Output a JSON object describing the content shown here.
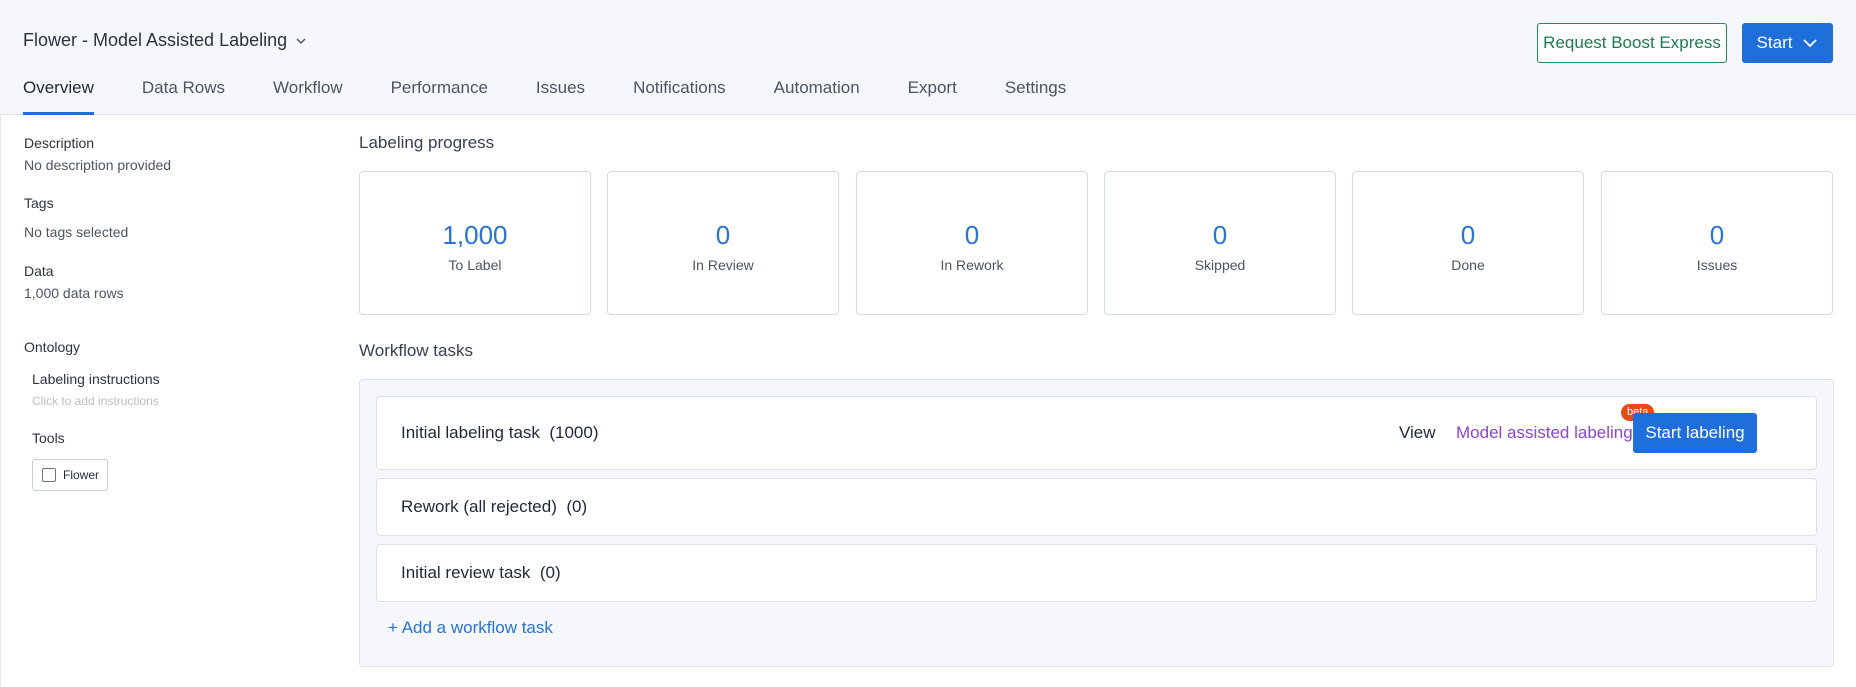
{
  "header": {
    "project_title": "Flower - Model Assisted Labeling",
    "boost_label": "Request Boost Express",
    "start_label": "Start"
  },
  "tabs": [
    {
      "label": "Overview",
      "active": true
    },
    {
      "label": "Data Rows"
    },
    {
      "label": "Workflow"
    },
    {
      "label": "Performance"
    },
    {
      "label": "Issues"
    },
    {
      "label": "Notifications"
    },
    {
      "label": "Automation"
    },
    {
      "label": "Export"
    },
    {
      "label": "Settings"
    }
  ],
  "sidebar": {
    "description_label": "Description",
    "description_value": "No description provided",
    "tags_label": "Tags",
    "tags_value": "No tags selected",
    "data_label": "Data",
    "data_value": "1,000 data rows",
    "ontology_label": "Ontology",
    "instructions_label": "Labeling instructions",
    "instructions_hint": "Click to add instructions",
    "tools_label": "Tools",
    "tool_name": "Flower"
  },
  "progress": {
    "title": "Labeling progress",
    "stats": [
      {
        "value": "1,000",
        "label": "To Label"
      },
      {
        "value": "0",
        "label": "In Review"
      },
      {
        "value": "0",
        "label": "In Rework"
      },
      {
        "value": "0",
        "label": "Skipped"
      },
      {
        "value": "0",
        "label": "Done"
      },
      {
        "value": "0",
        "label": "Issues"
      }
    ]
  },
  "workflow": {
    "title": "Workflow tasks",
    "tasks": [
      {
        "name": "Initial labeling task  (1000)"
      },
      {
        "name": "Rework (all rejected)  (0)"
      },
      {
        "name": "Initial review task  (0)"
      }
    ],
    "view_label": "View",
    "mal_label": "Model assisted labeling",
    "beta_label": "beta",
    "start_labeling_label": "Start labeling",
    "add_task_label": "+ Add a workflow task"
  },
  "colors": {
    "accent": "#1e6fd9",
    "boost_green": "#1f7a50",
    "mal_purple": "#8b46c9",
    "beta_orange": "#e64a19",
    "stat_blue": "#2a73d1"
  }
}
